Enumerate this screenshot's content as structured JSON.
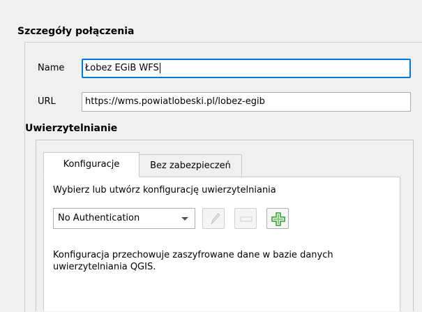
{
  "connection_group": {
    "title": "Szczegóły połączenia"
  },
  "name_field": {
    "label": "Name",
    "value": "Łobez EGiB WFS"
  },
  "url_field": {
    "label": "URL",
    "value": "https://wms.powiatlobeski.pl/lobez-egib"
  },
  "auth_group": {
    "title": "Uwierzytelnianie"
  },
  "tabs": [
    {
      "label": "Konfiguracje",
      "active": true
    },
    {
      "label": "Bez zabezpieczeń",
      "active": false
    }
  ],
  "config_tab": {
    "instruction": "Wybierz lub utwórz konfigurację uwierzytelniania",
    "auth_select": {
      "selected": "No Authentication"
    },
    "edit_button_icon": "pencil-icon",
    "remove_button_icon": "minus-icon",
    "add_button_icon": "plus-icon",
    "description_line1": "Konfiguracja przechowuje zaszyfrowane dane w bazie danych",
    "description_line2": "uwierzytelniania QGIS."
  },
  "colors": {
    "focus_border": "#0078d7",
    "add_icon_green": "#2e9c2e"
  }
}
